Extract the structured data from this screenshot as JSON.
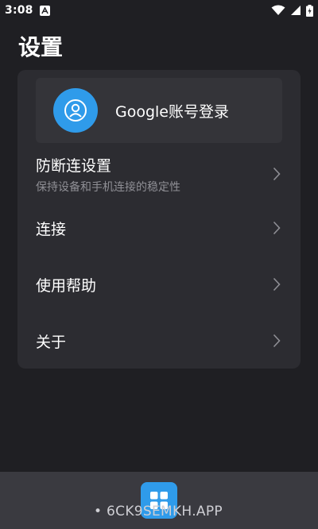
{
  "status_bar": {
    "time": "3:08",
    "notification_icon": "a-letter-icon",
    "icons": [
      "wifi-icon",
      "cellular-signal-icon",
      "battery-icon"
    ]
  },
  "page": {
    "title": "设置"
  },
  "account": {
    "label": "Google账号登录",
    "icon": "user-avatar-icon"
  },
  "menu": {
    "items": [
      {
        "label": "防断连设置",
        "subtitle": "保持设备和手机连接的稳定性"
      },
      {
        "label": "连接"
      },
      {
        "label": "使用帮助"
      },
      {
        "label": "关于"
      }
    ]
  },
  "bottom_bar": {
    "app_icon": "grid-app-icon",
    "watermark": "• 6CK9SEMKH.APP"
  },
  "colors": {
    "background": "#1f1f23",
    "card": "#2c2c31",
    "accent": "#2f9bea",
    "subtitle": "#8f8f95"
  }
}
